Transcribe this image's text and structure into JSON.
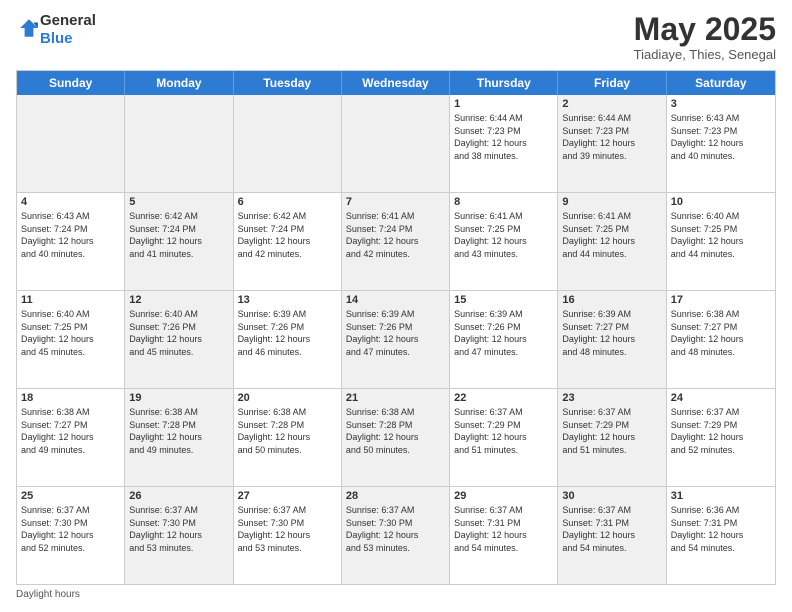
{
  "header": {
    "logo_line1": "General",
    "logo_line2": "Blue",
    "month": "May 2025",
    "location": "Tiadiaye, Thies, Senegal"
  },
  "days_of_week": [
    "Sunday",
    "Monday",
    "Tuesday",
    "Wednesday",
    "Thursday",
    "Friday",
    "Saturday"
  ],
  "weeks": [
    [
      {
        "day": "",
        "info": "",
        "shaded": true
      },
      {
        "day": "",
        "info": "",
        "shaded": true
      },
      {
        "day": "",
        "info": "",
        "shaded": true
      },
      {
        "day": "",
        "info": "",
        "shaded": true
      },
      {
        "day": "1",
        "info": "Sunrise: 6:44 AM\nSunset: 7:23 PM\nDaylight: 12 hours\nand 38 minutes.",
        "shaded": false
      },
      {
        "day": "2",
        "info": "Sunrise: 6:44 AM\nSunset: 7:23 PM\nDaylight: 12 hours\nand 39 minutes.",
        "shaded": true
      },
      {
        "day": "3",
        "info": "Sunrise: 6:43 AM\nSunset: 7:23 PM\nDaylight: 12 hours\nand 40 minutes.",
        "shaded": false
      }
    ],
    [
      {
        "day": "4",
        "info": "Sunrise: 6:43 AM\nSunset: 7:24 PM\nDaylight: 12 hours\nand 40 minutes.",
        "shaded": false
      },
      {
        "day": "5",
        "info": "Sunrise: 6:42 AM\nSunset: 7:24 PM\nDaylight: 12 hours\nand 41 minutes.",
        "shaded": true
      },
      {
        "day": "6",
        "info": "Sunrise: 6:42 AM\nSunset: 7:24 PM\nDaylight: 12 hours\nand 42 minutes.",
        "shaded": false
      },
      {
        "day": "7",
        "info": "Sunrise: 6:41 AM\nSunset: 7:24 PM\nDaylight: 12 hours\nand 42 minutes.",
        "shaded": true
      },
      {
        "day": "8",
        "info": "Sunrise: 6:41 AM\nSunset: 7:25 PM\nDaylight: 12 hours\nand 43 minutes.",
        "shaded": false
      },
      {
        "day": "9",
        "info": "Sunrise: 6:41 AM\nSunset: 7:25 PM\nDaylight: 12 hours\nand 44 minutes.",
        "shaded": true
      },
      {
        "day": "10",
        "info": "Sunrise: 6:40 AM\nSunset: 7:25 PM\nDaylight: 12 hours\nand 44 minutes.",
        "shaded": false
      }
    ],
    [
      {
        "day": "11",
        "info": "Sunrise: 6:40 AM\nSunset: 7:25 PM\nDaylight: 12 hours\nand 45 minutes.",
        "shaded": false
      },
      {
        "day": "12",
        "info": "Sunrise: 6:40 AM\nSunset: 7:26 PM\nDaylight: 12 hours\nand 45 minutes.",
        "shaded": true
      },
      {
        "day": "13",
        "info": "Sunrise: 6:39 AM\nSunset: 7:26 PM\nDaylight: 12 hours\nand 46 minutes.",
        "shaded": false
      },
      {
        "day": "14",
        "info": "Sunrise: 6:39 AM\nSunset: 7:26 PM\nDaylight: 12 hours\nand 47 minutes.",
        "shaded": true
      },
      {
        "day": "15",
        "info": "Sunrise: 6:39 AM\nSunset: 7:26 PM\nDaylight: 12 hours\nand 47 minutes.",
        "shaded": false
      },
      {
        "day": "16",
        "info": "Sunrise: 6:39 AM\nSunset: 7:27 PM\nDaylight: 12 hours\nand 48 minutes.",
        "shaded": true
      },
      {
        "day": "17",
        "info": "Sunrise: 6:38 AM\nSunset: 7:27 PM\nDaylight: 12 hours\nand 48 minutes.",
        "shaded": false
      }
    ],
    [
      {
        "day": "18",
        "info": "Sunrise: 6:38 AM\nSunset: 7:27 PM\nDaylight: 12 hours\nand 49 minutes.",
        "shaded": false
      },
      {
        "day": "19",
        "info": "Sunrise: 6:38 AM\nSunset: 7:28 PM\nDaylight: 12 hours\nand 49 minutes.",
        "shaded": true
      },
      {
        "day": "20",
        "info": "Sunrise: 6:38 AM\nSunset: 7:28 PM\nDaylight: 12 hours\nand 50 minutes.",
        "shaded": false
      },
      {
        "day": "21",
        "info": "Sunrise: 6:38 AM\nSunset: 7:28 PM\nDaylight: 12 hours\nand 50 minutes.",
        "shaded": true
      },
      {
        "day": "22",
        "info": "Sunrise: 6:37 AM\nSunset: 7:29 PM\nDaylight: 12 hours\nand 51 minutes.",
        "shaded": false
      },
      {
        "day": "23",
        "info": "Sunrise: 6:37 AM\nSunset: 7:29 PM\nDaylight: 12 hours\nand 51 minutes.",
        "shaded": true
      },
      {
        "day": "24",
        "info": "Sunrise: 6:37 AM\nSunset: 7:29 PM\nDaylight: 12 hours\nand 52 minutes.",
        "shaded": false
      }
    ],
    [
      {
        "day": "25",
        "info": "Sunrise: 6:37 AM\nSunset: 7:30 PM\nDaylight: 12 hours\nand 52 minutes.",
        "shaded": false
      },
      {
        "day": "26",
        "info": "Sunrise: 6:37 AM\nSunset: 7:30 PM\nDaylight: 12 hours\nand 53 minutes.",
        "shaded": true
      },
      {
        "day": "27",
        "info": "Sunrise: 6:37 AM\nSunset: 7:30 PM\nDaylight: 12 hours\nand 53 minutes.",
        "shaded": false
      },
      {
        "day": "28",
        "info": "Sunrise: 6:37 AM\nSunset: 7:30 PM\nDaylight: 12 hours\nand 53 minutes.",
        "shaded": true
      },
      {
        "day": "29",
        "info": "Sunrise: 6:37 AM\nSunset: 7:31 PM\nDaylight: 12 hours\nand 54 minutes.",
        "shaded": false
      },
      {
        "day": "30",
        "info": "Sunrise: 6:37 AM\nSunset: 7:31 PM\nDaylight: 12 hours\nand 54 minutes.",
        "shaded": true
      },
      {
        "day": "31",
        "info": "Sunrise: 6:36 AM\nSunset: 7:31 PM\nDaylight: 12 hours\nand 54 minutes.",
        "shaded": false
      }
    ]
  ],
  "footer": {
    "note": "Daylight hours"
  }
}
